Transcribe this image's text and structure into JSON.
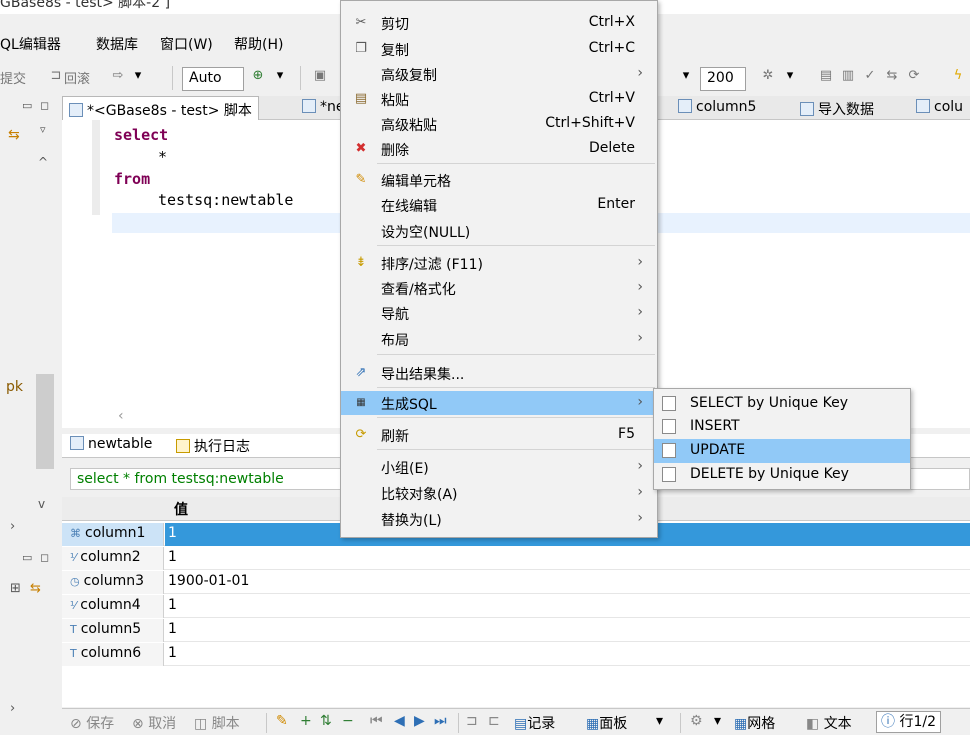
{
  "window": {
    "title": "GBase8s - test> 脚本-2 ]"
  },
  "menubar": {
    "items": [
      "QL编辑器",
      "数据库",
      "窗口(W)",
      "帮助(H)"
    ]
  },
  "toolbar": {
    "commit_label": "提交",
    "rollback_label": "回滚",
    "mode_value": "Auto",
    "rows_value": "200"
  },
  "left_pane": {
    "label": "pk"
  },
  "tabs": [
    {
      "label": "*<GBase8s - test> 脚本",
      "active": true
    },
    {
      "label": "*ne"
    },
    {
      "label": "column5"
    },
    {
      "label": "导入数据"
    },
    {
      "label": "colu"
    }
  ],
  "editor": {
    "lines": [
      "select",
      "*",
      "from",
      "testsq:newtable"
    ]
  },
  "result_tabs": [
    "newtable",
    "执行日志"
  ],
  "query_text": "select * from testsq:newtable",
  "grid": {
    "header": "值",
    "rows": [
      {
        "name": "column1",
        "value": "1",
        "selected": true
      },
      {
        "name": "column2",
        "value": "1"
      },
      {
        "name": "column3",
        "value": "1900-01-01"
      },
      {
        "name": "column4",
        "value": "1"
      },
      {
        "name": "column5",
        "value": "1"
      },
      {
        "name": "column6",
        "value": "1"
      }
    ]
  },
  "statusbar": {
    "save": "保存",
    "cancel": "取消",
    "script": "脚本",
    "records": "记录",
    "panel": "面板",
    "grid": "网格",
    "text": "文本",
    "row_info": "行1/2"
  },
  "context_menu": {
    "items": [
      {
        "label": "剪切",
        "shortcut": "Ctrl+X",
        "icon": "scissors-icon"
      },
      {
        "label": "复制",
        "shortcut": "Ctrl+C",
        "icon": "copy-icon"
      },
      {
        "label": "高级复制",
        "submenu": true
      },
      {
        "label": "粘贴",
        "shortcut": "Ctrl+V",
        "icon": "paste-icon"
      },
      {
        "label": "高级粘贴",
        "shortcut": "Ctrl+Shift+V"
      },
      {
        "label": "删除",
        "shortcut": "Delete",
        "icon": "delete-icon"
      },
      {
        "label": "编辑单元格",
        "icon": "edit-icon"
      },
      {
        "label": "在线编辑",
        "shortcut": "Enter"
      },
      {
        "label": "设为空(NULL)"
      },
      {
        "label": "排序/过滤 (F11)",
        "submenu": true,
        "icon": "filter-icon"
      },
      {
        "label": "查看/格式化",
        "submenu": true
      },
      {
        "label": "导航",
        "submenu": true
      },
      {
        "label": "布局",
        "submenu": true
      },
      {
        "label": "导出结果集...",
        "icon": "export-icon"
      },
      {
        "label": "生成SQL",
        "submenu": true,
        "highlighted": true,
        "icon": "sql-icon"
      },
      {
        "label": "刷新",
        "shortcut": "F5",
        "icon": "refresh-icon"
      },
      {
        "label": "小组(E)",
        "submenu": true
      },
      {
        "label": "比较对象(A)",
        "submenu": true
      },
      {
        "label": "替换为(L)",
        "submenu": true
      }
    ]
  },
  "submenu": {
    "items": [
      {
        "label": "SELECT by Unique Key"
      },
      {
        "label": "INSERT"
      },
      {
        "label": "UPDATE",
        "highlighted": true
      },
      {
        "label": "DELETE by Unique Key"
      }
    ]
  },
  "colors": {
    "highlight": "#91c9f7",
    "selected_cell": "#3498db",
    "keyword": "#7f0055"
  }
}
